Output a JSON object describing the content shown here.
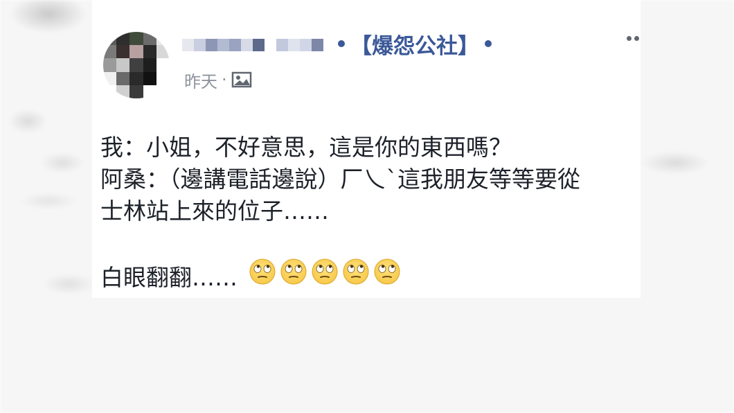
{
  "post": {
    "author_display": "blurred-name",
    "group_name": "【爆怨公社】",
    "timestamp": "昨天",
    "separator": "·",
    "privacy_icon": "photo-icon",
    "lines": [
      "我：小姐，不好意思，這是你的東西嗎？",
      "阿桑：（邊講電話邊說）厂乀ˋ這我朋友等等要從",
      "士林站上來的位子……"
    ],
    "last_line_text": "白眼翻翻……",
    "emoji_name": "face-with-rolling-eyes-icon",
    "emoji_count": 5
  },
  "colors": {
    "link_blue": "#3b5998",
    "text": "#1d2129",
    "meta_gray": "#8d949e",
    "emoji_yellow": "#f7c84a"
  }
}
